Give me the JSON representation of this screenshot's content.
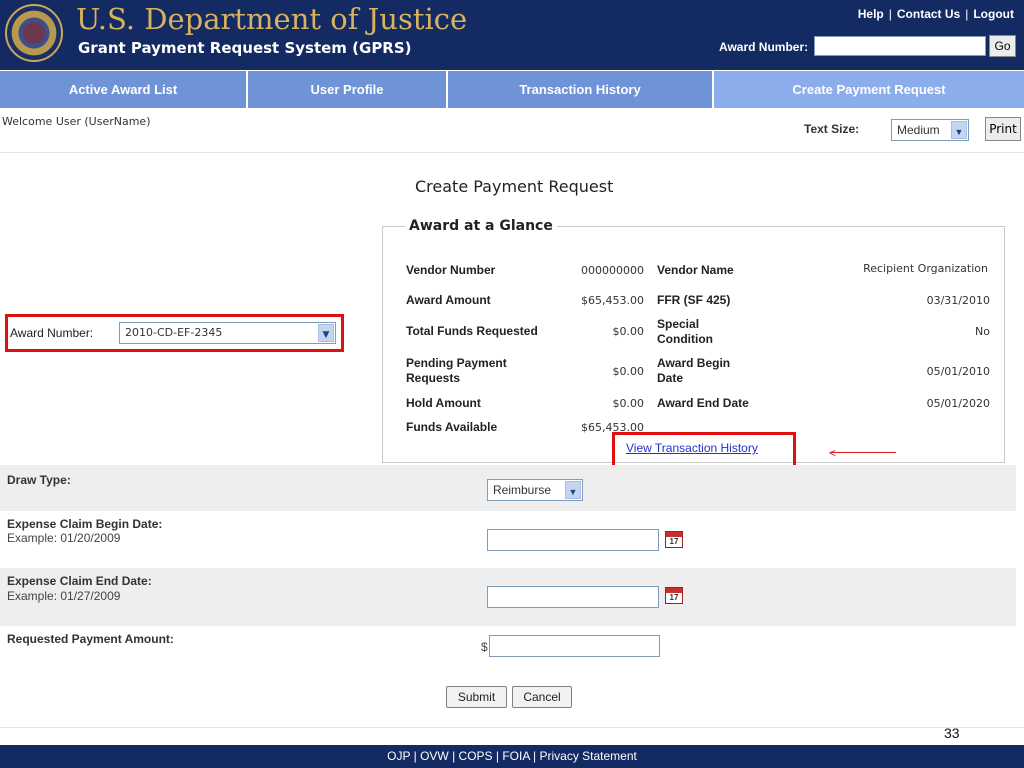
{
  "header": {
    "title": "U.S. Department of Justice",
    "subtitle": "Grant Payment Request System (GPRS)",
    "links": [
      "Help",
      "Contact Us",
      "Logout"
    ],
    "award_number_label": "Award Number:",
    "award_number_value": "",
    "go_label": "Go"
  },
  "nav": {
    "tabs": [
      {
        "label": "Active Award List"
      },
      {
        "label": "User Profile"
      },
      {
        "label": "Transaction History"
      },
      {
        "label": "Create Payment Request"
      }
    ],
    "active_tab": "Create Payment Request"
  },
  "welcome": "Welcome User (UserName)",
  "text_size": {
    "label": "Text Size:",
    "selected": "Medium",
    "print_label": "Print"
  },
  "main": {
    "title": "Create Payment Request",
    "side_award_label": "Award Number:",
    "side_award_value": "2010-CD-EF-2345",
    "glance": {
      "legend": "Award at a Glance",
      "left": [
        {
          "label": "Vendor Number",
          "value": "000000000"
        },
        {
          "label": "Award Amount",
          "value": "$65,453.00"
        },
        {
          "label": "Total Funds Requested",
          "value": "$0.00"
        },
        {
          "label": "Pending Payment Requests",
          "value": "$0.00"
        },
        {
          "label": "Hold Amount",
          "value": "$0.00"
        },
        {
          "label": "Funds Available",
          "value": "$65,453.00"
        }
      ],
      "right": [
        {
          "label": "Vendor Name",
          "value": "Recipient Organization"
        },
        {
          "label": "FFR (SF 425)",
          "value": "03/31/2010"
        },
        {
          "label": "Special Condition",
          "value": "No"
        },
        {
          "label": "Award Begin Date",
          "value": "05/01/2010"
        },
        {
          "label": "Award End Date",
          "value": "05/01/2020"
        }
      ],
      "link": "View Transaction History"
    },
    "form": {
      "draw_type_label": "Draw Type:",
      "draw_type_value": "Reimburse",
      "begin_label": "Expense Claim Begin Date:",
      "begin_example": "Example: 01/20/2009",
      "begin_value": "",
      "end_label": "Expense Claim End Date:",
      "end_example": "Example: 01/27/2009",
      "end_value": "",
      "amount_label": "Requested Payment Amount:",
      "currency": "$",
      "amount_value": "",
      "calendar_day": "17",
      "submit_label": "Submit",
      "cancel_label": "Cancel"
    }
  },
  "footer": {
    "links": [
      "OJP",
      "OVW",
      "COPS",
      "FOIA",
      "Privacy Statement"
    ]
  },
  "slide_number": "33",
  "colors": {
    "header_bg": "#142a63",
    "title_gold": "#d8b35c",
    "nav_bg": "#6e93d6",
    "nav_active": "#8cadec",
    "highlight_red": "#e01010"
  }
}
